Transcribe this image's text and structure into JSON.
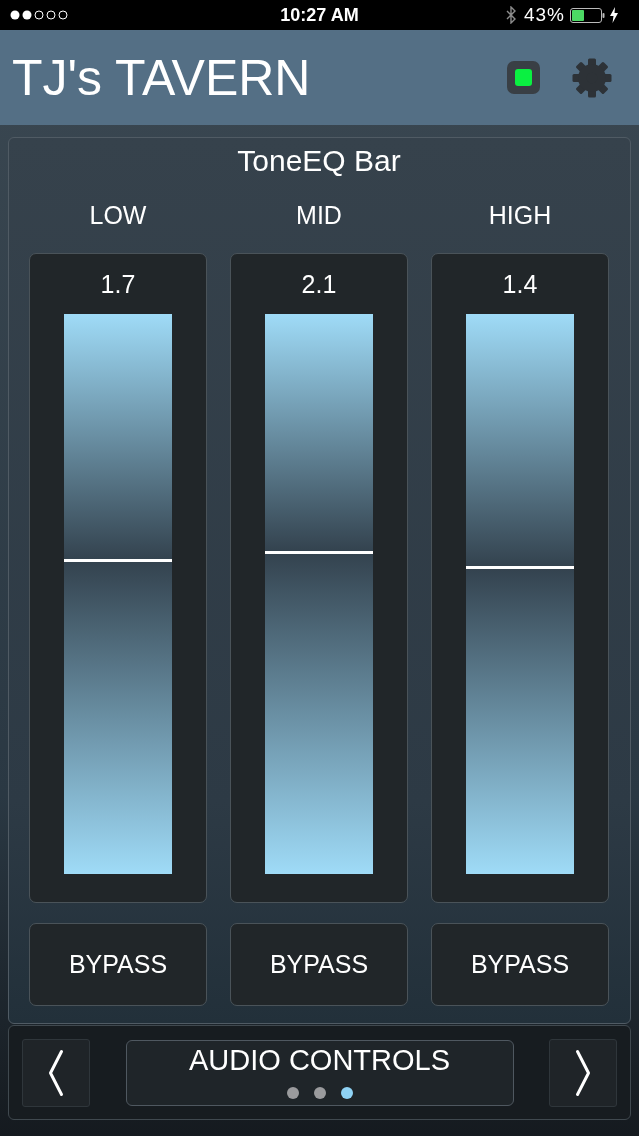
{
  "status_bar": {
    "time": "10:27 AM",
    "battery": "43%"
  },
  "header": {
    "title": "TJ's TAVERN",
    "status_light": {
      "on": true
    }
  },
  "panel": {
    "title": "ToneEQ Bar",
    "channels": [
      {
        "name": "LOW",
        "value": "1.7",
        "level": 0.56,
        "button": "BYPASS"
      },
      {
        "name": "MID",
        "value": "2.1",
        "level": 0.575,
        "button": "BYPASS"
      },
      {
        "name": "HIGH",
        "value": "1.4",
        "level": 0.548,
        "button": "BYPASS"
      }
    ]
  },
  "nav": {
    "title": "AUDIO CONTROLS",
    "pages": [
      {
        "selected": false
      },
      {
        "selected": false
      },
      {
        "selected": true
      }
    ]
  }
}
